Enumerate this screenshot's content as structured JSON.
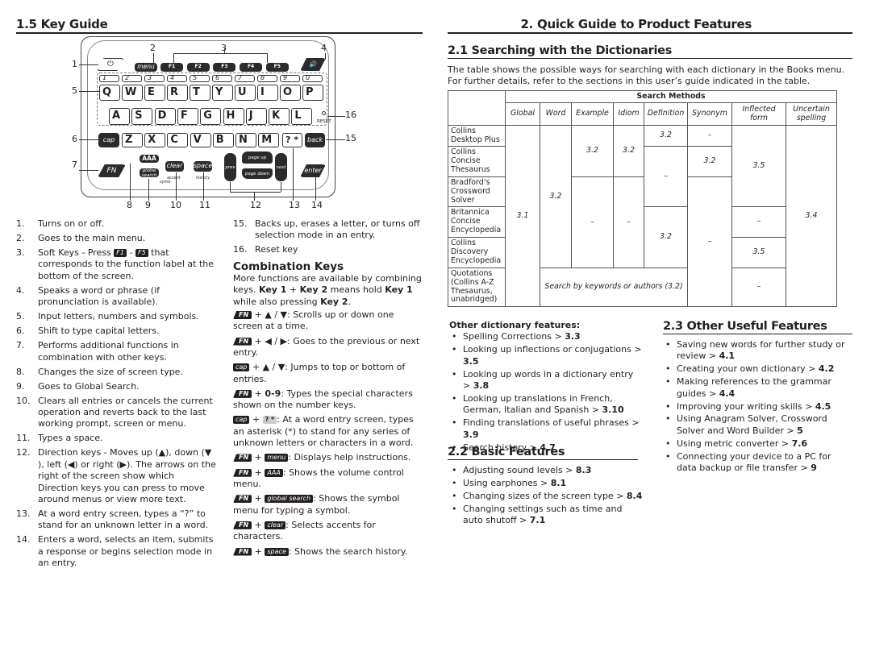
{
  "key_guide": {
    "title": "1.5 Key Guide",
    "diagram": {
      "top_keys": {
        "power": "⏻",
        "menu": "menu",
        "f": [
          "F1",
          "F2",
          "F3",
          "F4",
          "F5"
        ],
        "speaker": "🔊"
      },
      "number_row": [
        "1",
        "2",
        "3",
        "4",
        "5",
        "6",
        "7",
        "8",
        "9",
        "0"
      ],
      "number_row_symbols": [
        ";",
        "*",
        "!",
        "!",
        "@",
        "-",
        "/",
        "_",
        "(",
        ")"
      ],
      "row1": [
        "Q",
        "W",
        "E",
        "R",
        "T",
        "Y",
        "U",
        "I",
        "O",
        "P"
      ],
      "row2": [
        "A",
        "S",
        "D",
        "F",
        "G",
        "H",
        "J",
        "K",
        "L"
      ],
      "row3": [
        "Z",
        "X",
        "C",
        "V",
        "B",
        "N",
        "M"
      ],
      "cap": "cap",
      "qmark": "? *",
      "back": "back",
      "reset": "RESET",
      "fn": "FN",
      "aaa": "AAA",
      "global_search": "global search",
      "symb": "symb",
      "clear": "clear",
      "accent": "accent",
      "space": "space",
      "history": "history",
      "prev": "prev",
      "page_up": "page up",
      "page_down": "page down",
      "next": "next",
      "enter": "enter",
      "callouts": [
        "1",
        "2",
        "3",
        "4",
        "5",
        "6",
        "7",
        "8",
        "9",
        "10",
        "11",
        "12",
        "13",
        "14",
        "15",
        "16"
      ]
    },
    "items": [
      {
        "n": "1.",
        "t": [
          {
            "text": "Turns on or off."
          }
        ]
      },
      {
        "n": "2.",
        "t": [
          {
            "text": "Goes to the main menu."
          }
        ]
      },
      {
        "n": "3.",
        "t": [
          {
            "text": "Soft Keys - Press "
          },
          {
            "key": "F1"
          },
          {
            "text": " - "
          },
          {
            "key": "F5"
          },
          {
            "text": " that corresponds to the function label at the bottom of the screen."
          }
        ]
      },
      {
        "n": "4.",
        "t": [
          {
            "text": "Speaks a word or phrase (if pronunciation is available)."
          }
        ]
      },
      {
        "n": "5.",
        "t": [
          {
            "text": "Input letters, numbers and symbols."
          }
        ]
      },
      {
        "n": "6.",
        "t": [
          {
            "text": "Shift to type capital letters."
          }
        ]
      },
      {
        "n": "7.",
        "t": [
          {
            "text": "Performs additional functions in combination with other keys."
          }
        ]
      },
      {
        "n": "8.",
        "t": [
          {
            "text": "Changes the size of screen type."
          }
        ]
      },
      {
        "n": "9.",
        "t": [
          {
            "text": "Goes to Global Search."
          }
        ]
      },
      {
        "n": "10.",
        "t": [
          {
            "text": "Clears all entries or cancels the current operation and reverts back to the last working prompt, screen or menu."
          }
        ]
      },
      {
        "n": "11.",
        "t": [
          {
            "text": "Types a space."
          }
        ]
      },
      {
        "n": "12.",
        "t": [
          {
            "text": "Direction keys - Moves up (▲), down (▼ ), left (◀) or right (▶). The arrows on the right of the screen show which Direction keys you can press to move around menus or view more text."
          }
        ]
      },
      {
        "n": "13.",
        "t": [
          {
            "text": "At a word entry screen, types a “?” to stand for an unknown letter in a word."
          }
        ]
      },
      {
        "n": "14.",
        "t": [
          {
            "text": "Enters a word, selects an item, submits a response or begins selection mode in an entry."
          }
        ]
      },
      {
        "n": "15.",
        "t": [
          {
            "text": "Backs up, erases a letter, or turns off selection mode in an entry."
          }
        ]
      },
      {
        "n": "16.",
        "t": [
          {
            "text": "Reset key"
          }
        ]
      }
    ],
    "combination": {
      "title": "Combination Keys",
      "intro": [
        {
          "text": "More functions are available by combining keys. "
        },
        {
          "bold": "Key 1"
        },
        {
          "text": " + "
        },
        {
          "bold": "Key 2"
        },
        {
          "text": " means hold "
        },
        {
          "bold": "Key 1"
        },
        {
          "text": " while also pressing "
        },
        {
          "bold": "Key 2"
        },
        {
          "text": "."
        }
      ],
      "entries": [
        [
          {
            "fn": "FN"
          },
          {
            "text": " + ▲ / ▼: Scrolls up or down one screen at a time."
          }
        ],
        [
          {
            "fn": "FN"
          },
          {
            "text": " + ◀ / ▶: Goes to the previous or next entry."
          }
        ],
        [
          {
            "key": "cap"
          },
          {
            "text": " + ▲ / ▼: Jumps to top or bottom of entries."
          }
        ],
        [
          {
            "fn": "FN"
          },
          {
            "text": " + "
          },
          {
            "bold": "0-9"
          },
          {
            "text": ": Types the special characters shown on the number keys."
          }
        ],
        [
          {
            "key": "cap"
          },
          {
            "text": " + "
          },
          {
            "grey": "? *"
          },
          {
            "text": ": At a word entry screen, types an asterisk (*) to stand for any series of unknown letters or characters in a word."
          }
        ],
        [
          {
            "fn": "FN"
          },
          {
            "text": " + "
          },
          {
            "key": "menu"
          },
          {
            "text": ": Displays help instructions."
          }
        ],
        [
          {
            "fn": "FN"
          },
          {
            "text": " + "
          },
          {
            "key": "AAA"
          },
          {
            "text": ": Shows the volume control menu."
          }
        ],
        [
          {
            "fn": "FN"
          },
          {
            "text": " + "
          },
          {
            "key": "global search"
          },
          {
            "text": ": Shows the symbol menu for typing a symbol."
          }
        ],
        [
          {
            "fn": "FN"
          },
          {
            "text": " + "
          },
          {
            "key": "clear"
          },
          {
            "text": ": Selects accents for characters."
          }
        ],
        [
          {
            "fn": "FN"
          },
          {
            "text": " + "
          },
          {
            "key": "space"
          },
          {
            "text": ": Shows the search history."
          }
        ]
      ]
    }
  },
  "quick_guide": {
    "title": "2. Quick Guide to Product Features",
    "searching": {
      "title": "2.1 Searching with the Dictionaries",
      "intro": "The table shows the possible ways for searching with each dictionary in the Books menu. For further details, refer to the sections in this user’s guide indicated in the table.",
      "table": {
        "group_header": "Search Methods",
        "columns": [
          "Global",
          "Word",
          "Example",
          "Idiom",
          "Definition",
          "Synonym",
          "Inflected form",
          "Uncertain spelling"
        ],
        "rows": [
          "Collins Desktop Plus",
          "Collins Concise Thesaurus",
          "Bradford’s Crossword Solver",
          "Britannica Concise Encyclopedia",
          "Collins Discovery Encyclopedia",
          "Quotations (Collins A-Z Thesaurus, unabridged)"
        ],
        "cells": {
          "global_all": "3.1",
          "word_r1_5": "3.2",
          "example_r1_2": "3.2",
          "idiom_r1_2": "3.2",
          "definition_r1": "3.2",
          "synonym_r1": "–",
          "inflected_r1_3": "3.5",
          "uncertain_all": "3.4",
          "definition_r2_3": "–",
          "synonym_r2": "3.2",
          "example_r3_5": "–",
          "idiom_r3_5": "–",
          "synonym_r3_6": "–",
          "definition_r4_5": "3.2",
          "inflected_r4": "–",
          "inflected_r5": "3.5",
          "quotations_span": "Search by keywords or authors (3.2)",
          "inflected_r6": "–"
        }
      },
      "other_title": "Other dictionary features:",
      "other": [
        [
          {
            "text": "Spelling Corrections > "
          },
          {
            "bold": "3.3"
          }
        ],
        [
          {
            "text": "Looking up inflections or conjugations > "
          },
          {
            "bold": "3.5"
          }
        ],
        [
          {
            "text": "Looking up words in a dictionary entry > "
          },
          {
            "bold": "3.8"
          }
        ],
        [
          {
            "text": "Looking up translations in French, German, Italian and Spanish > "
          },
          {
            "bold": "3.10"
          }
        ],
        [
          {
            "text": "Finding translations of useful phrases > "
          },
          {
            "bold": "3.9"
          }
        ],
        [
          {
            "text": "Search history > "
          },
          {
            "bold": "4.7"
          }
        ]
      ]
    },
    "basic": {
      "title": "2.2 Basic Features",
      "items": [
        [
          {
            "text": "Adjusting sound levels > "
          },
          {
            "bold": "8.3"
          }
        ],
        [
          {
            "text": "Using earphones > "
          },
          {
            "bold": "8.1"
          }
        ],
        [
          {
            "text": "Changing sizes of the screen type > "
          },
          {
            "bold": "8.4"
          }
        ],
        [
          {
            "text": "Changing settings such as time and auto shutoff > "
          },
          {
            "bold": "7.1"
          }
        ]
      ]
    },
    "useful": {
      "title": "2.3 Other Useful Features",
      "items": [
        [
          {
            "text": "Saving new words for further study or review >  "
          },
          {
            "bold": "4.1"
          }
        ],
        [
          {
            "text": "Creating your own dictionary > "
          },
          {
            "bold": "4.2"
          }
        ],
        [
          {
            "text": "Making references to the grammar guides > "
          },
          {
            "bold": "4.4"
          }
        ],
        [
          {
            "text": "Improving your writing skills > "
          },
          {
            "bold": "4.5"
          }
        ],
        [
          {
            "text": "Using Anagram Solver, Crossword Solver and Word Builder > "
          },
          {
            "bold": "5"
          }
        ],
        [
          {
            "text": "Using metric converter > "
          },
          {
            "bold": "7.6"
          }
        ],
        [
          {
            "text": "Connecting your device to a PC for data backup or file transfer > "
          },
          {
            "bold": "9"
          }
        ]
      ]
    }
  }
}
